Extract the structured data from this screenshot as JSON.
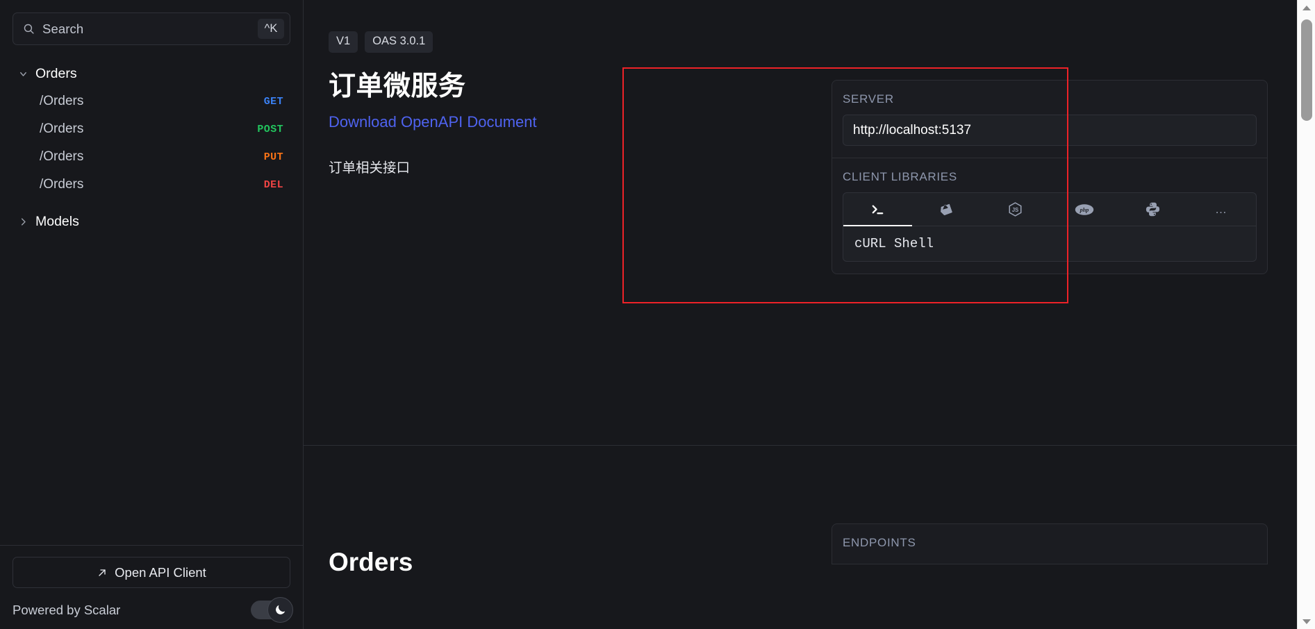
{
  "sidebar": {
    "search": {
      "placeholder": "Search",
      "shortcut": "^K",
      "icon": "search-icon"
    },
    "groups": [
      {
        "label": "Orders",
        "expanded": true,
        "icon": "chevron-down-icon",
        "items": [
          {
            "path": "/Orders",
            "method": "GET",
            "color": "#3b82f6"
          },
          {
            "path": "/Orders",
            "method": "POST",
            "color": "#22c55e"
          },
          {
            "path": "/Orders",
            "method": "PUT",
            "color": "#f97316"
          },
          {
            "path": "/Orders",
            "method": "DEL",
            "color": "#ef4444"
          }
        ]
      },
      {
        "label": "Models",
        "expanded": false,
        "icon": "chevron-right-icon",
        "items": []
      }
    ],
    "footer": {
      "open_client_label": "Open API Client",
      "open_client_icon": "arrow-up-right-icon",
      "powered_by": "Powered by Scalar",
      "theme_toggle": {
        "state": "dark",
        "icon": "moon-icon"
      }
    }
  },
  "main": {
    "intro": {
      "badges": [
        "V1",
        "OAS 3.0.1"
      ],
      "title": "订单微服务",
      "download_link": "Download OpenAPI Document",
      "description": "订单相关接口"
    },
    "server_card": {
      "server_label": "SERVER",
      "server_url": "http://localhost:5137",
      "client_libraries_label": "CLIENT LIBRARIES",
      "tabs": [
        {
          "name": "shell-terminal-icon",
          "active": true
        },
        {
          "name": "ruby-icon",
          "active": false
        },
        {
          "name": "nodejs-icon",
          "active": false
        },
        {
          "name": "php-icon",
          "active": false
        },
        {
          "name": "python-icon",
          "active": false
        },
        {
          "name": "more-options-icon",
          "active": false,
          "label": "…"
        }
      ],
      "selected_library": "cURL Shell"
    },
    "orders_section": {
      "title": "Orders",
      "endpoints_label": "ENDPOINTS"
    }
  },
  "highlight": {
    "color": "#ee2228"
  },
  "scrollbar": {
    "up_icon": "scroll-up-arrow-icon",
    "down_icon": "scroll-down-arrow-icon"
  }
}
